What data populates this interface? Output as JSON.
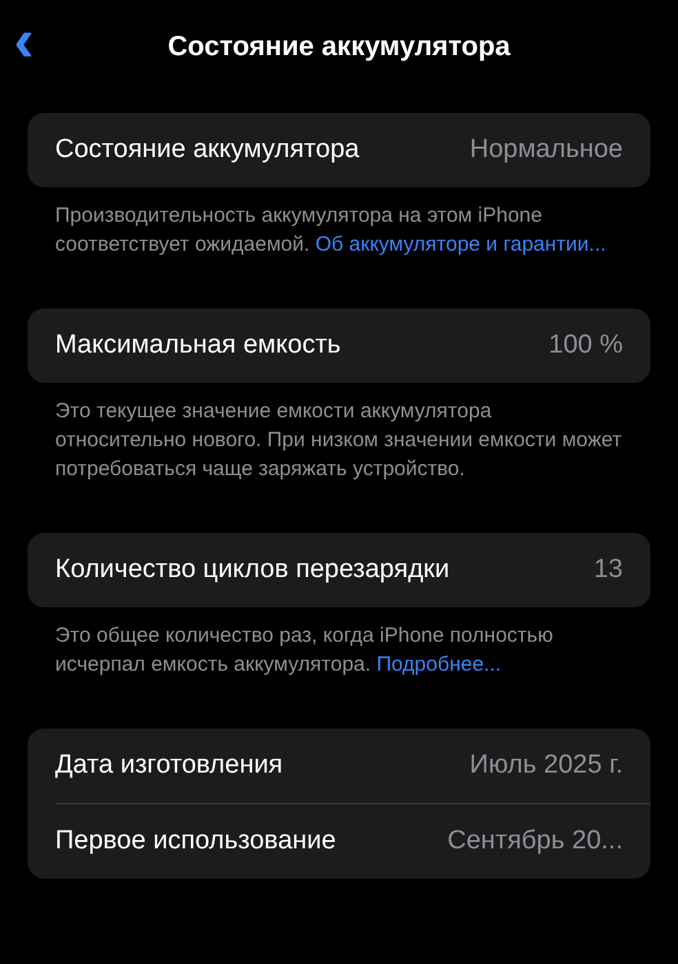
{
  "nav": {
    "back": "‹",
    "title": "Состояние аккумулятора"
  },
  "sections": [
    {
      "rows": [
        {
          "label": "Состояние аккумулятора",
          "value": "Нормальное"
        }
      ],
      "footer": {
        "text": "Производительность аккумулятора на этом iPhone соответствует ожидаемой.",
        "link": "Об аккумуляторе и гарантии..."
      }
    },
    {
      "rows": [
        {
          "label": "Максимальная емкость",
          "value": "100 %"
        }
      ],
      "footer": {
        "text": "Это текущее значение емкости аккумулятора относительно нового. При низком значении емкости может потребоваться чаще заряжать устройство."
      }
    },
    {
      "rows": [
        {
          "label": "Количество циклов перезарядки",
          "value": "13"
        }
      ],
      "footer": {
        "text": "Это общее количество раз, когда iPhone полностью исчерпал емкость аккумулятора.",
        "link": "Подробнее..."
      }
    },
    {
      "rows": [
        {
          "label": "Дата изготовления",
          "value": "Июль 2025 г."
        },
        {
          "label": "Первое использование",
          "value": "Сентябрь 20..."
        }
      ]
    }
  ]
}
